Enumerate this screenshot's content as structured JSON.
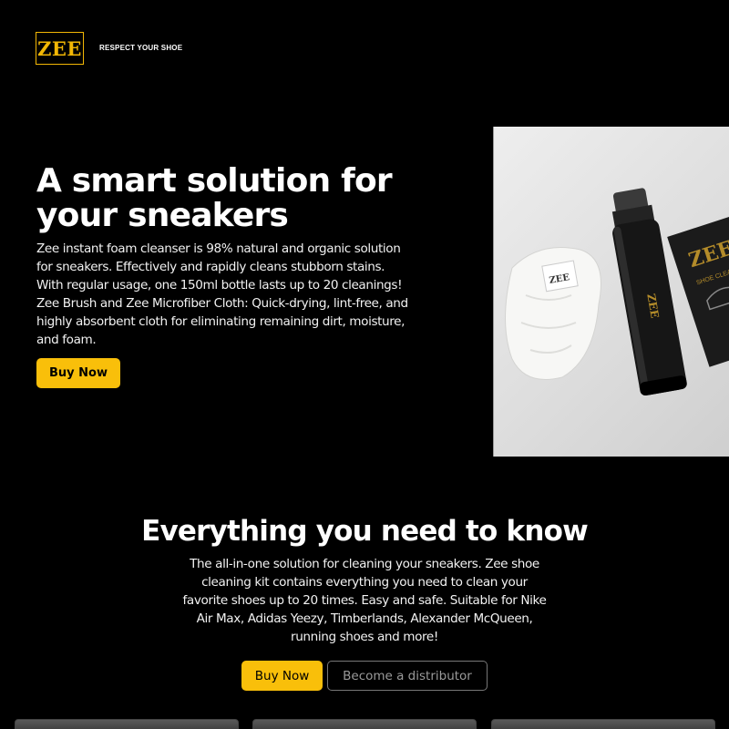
{
  "header": {
    "logo_text": "ZEE",
    "tagline": "RESPECT YOUR SHOE"
  },
  "hero": {
    "title": "A smart solution for your sneakers",
    "description": "Zee instant foam cleanser is 98% natural and organic solution for sneakers. Effectively and rapidly cleans stubborn stains. With regular usage, one 150ml bottle lasts up to 20 cleanings! Zee Brush and Zee Microfiber Cloth: Quick-drying, lint-free, and highly absorbent cloth for eliminating remaining dirt, moisture, and foam.",
    "buy_label": "Buy Now",
    "image": {
      "bottle_label": "ZEE",
      "box_label": "ZEE",
      "box_subtitle": "SHOE CLEANING KIT",
      "cloth_label": "ZEE"
    }
  },
  "section": {
    "title": "Everything you need to know",
    "description": "The all-in-one solution for cleaning your sneakers. Zee shoe cleaning kit contains everything you need to clean your favorite shoes up to 20 times. Easy and safe. Suitable for Nike Air Max, Adidas Yeezy, Timberlands, Alexander McQueen, running shoes and more!",
    "buy_label": "Buy Now",
    "distributor_label": "Become a distributor"
  },
  "colors": {
    "background": "#000000",
    "accent": "#f9bf0a",
    "logo": "#f2b705"
  }
}
